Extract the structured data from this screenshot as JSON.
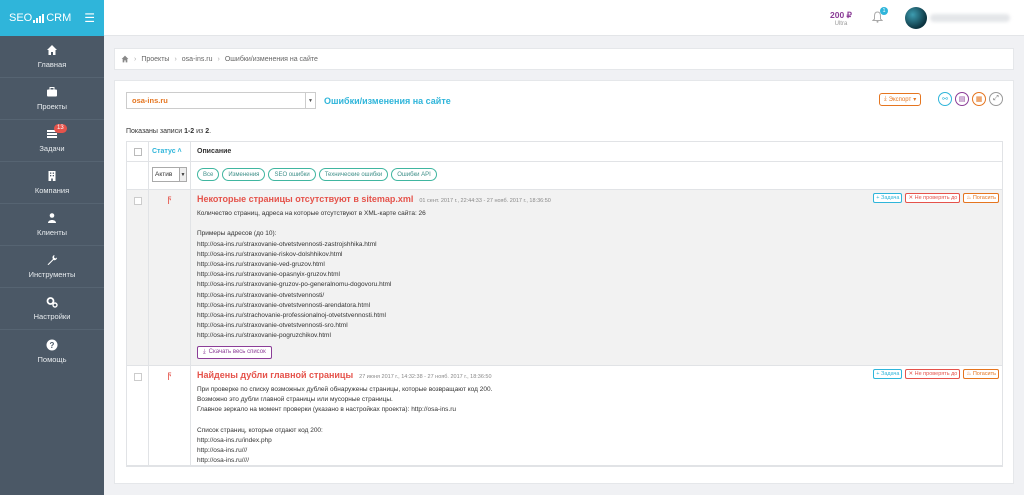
{
  "app": {
    "logo_left": "SEO",
    "logo_right": "CRM"
  },
  "sidebar": {
    "items": [
      {
        "label": "Главная",
        "icon": "home-icon"
      },
      {
        "label": "Проекты",
        "icon": "briefcase-icon"
      },
      {
        "label": "Задачи",
        "icon": "tasks-icon",
        "badge": "13"
      },
      {
        "label": "Компания",
        "icon": "building-icon"
      },
      {
        "label": "Клиенты",
        "icon": "users-icon"
      },
      {
        "label": "Инструменты",
        "icon": "wrench-icon"
      },
      {
        "label": "Настройки",
        "icon": "gears-icon"
      },
      {
        "label": "Помощь",
        "icon": "help-icon"
      }
    ]
  },
  "topbar": {
    "balance": "200 ₽",
    "plan": "Ultra",
    "notifications": "1"
  },
  "breadcrumb": {
    "items": [
      "Проекты",
      "osa-ins.ru",
      "Ошибки/изменения на сайте"
    ]
  },
  "toolbar": {
    "project": "osa-ins.ru",
    "title": "Ошибки/изменения на сайте",
    "export": "Экспорт"
  },
  "summary": {
    "prefix": "Показаны записи ",
    "range": "1-2",
    "mid": " из ",
    "total": "2",
    "suffix": "."
  },
  "table": {
    "col_status": "Статус",
    "col_desc": "Описание",
    "status_value": "Актив",
    "filters": [
      "Все",
      "Изменения",
      "SEO ошибки",
      "Технические ошибки",
      "Ошибки API"
    ]
  },
  "actions": {
    "task": "Задача",
    "nocheck": "Не проверять до",
    "fix": "Погасить"
  },
  "issues": [
    {
      "title": "Некоторые страницы отсутствуют в sitemap.xml",
      "dates": "01 сент. 2017 г., 22:44:33 - 27 нояб. 2017 г., 18:36:50",
      "lines": [
        "Количество страниц, адреса на которые отсутствуют в XML-карте сайта: 26",
        "",
        "Примеры адресов (до 10):",
        "http://osa-ins.ru/straxovanie-otvetstvennosti-zastrojshhika.html",
        "http://osa-ins.ru/straxovanie-riskov-dolshhikov.html",
        "http://osa-ins.ru/straxovanie-ved-gruzov.html",
        "http://osa-ins.ru/straxovanie-opasnyix-gruzov.html",
        "http://osa-ins.ru/straxovanie-gruzov-po-generalnomu-dogovoru.html",
        "http://osa-ins.ru/straxovanie-otvetstvennosti/",
        "http://osa-ins.ru/straxovanie-otvetstvennosti-arendatora.html",
        "http://osa-ins.ru/strachovanie-professionalnoj-otvetstvennosti.html",
        "http://osa-ins.ru/straxovanie-otvetstvennosti-sro.html",
        "http://osa-ins.ru/straxovanie-pogruzchikov.html"
      ],
      "download": "Скачать весь список"
    },
    {
      "title": "Найдены дубли главной страницы",
      "dates": "27 июня 2017 г., 14:32:38 - 27 нояб. 2017 г., 18:36:50",
      "lines": [
        "При проверке по списку возможных дублей обнаружены страницы, которые возвращают код 200.",
        "Возможно это дубли главной страницы или мусорные страницы.",
        "Главное зеркало на момент проверки (указано в настройках проекта): http://osa-ins.ru",
        "",
        "Список страниц, которые отдают код 200:",
        "http://osa-ins.ru/index.php",
        "http://osa-ins.ru///",
        "http://osa-ins.ru////"
      ]
    }
  ],
  "colors": {
    "accent": "#2fb5da",
    "error": "#e5534b",
    "orange": "#e5751f",
    "purple": "#8b3d97",
    "sidebar": "#4b5866"
  }
}
